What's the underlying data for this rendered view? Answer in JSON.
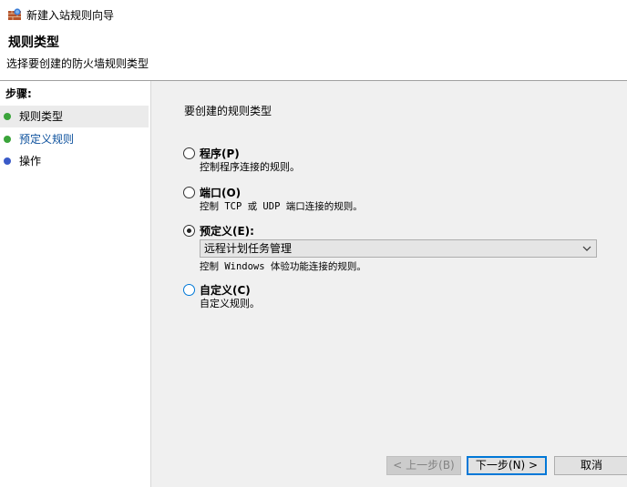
{
  "window": {
    "title": "新建入站规则向导",
    "icon": "firewall-shield-icon"
  },
  "header": {
    "title": "规则类型",
    "subtitle": "选择要创建的防火墙规则类型"
  },
  "steps": {
    "title": "步骤:",
    "items": [
      {
        "label": "规则类型",
        "color": "#3aa43a",
        "selected": true
      },
      {
        "label": "预定义规则",
        "color": "#3aa43a",
        "selected": false
      },
      {
        "label": "操作",
        "color": "#3a5ac8",
        "selected": false
      }
    ]
  },
  "content": {
    "title": "要创建的规则类型",
    "options": [
      {
        "label": "程序(P)",
        "desc": "控制程序连接的规则。",
        "checked": false
      },
      {
        "label": "端口(O)",
        "desc": "控制 TCP 或 UDP 端口连接的规则。",
        "checked": false
      },
      {
        "label": "预定义(E):",
        "desc": "控制 Windows 体验功能连接的规则。",
        "checked": true
      },
      {
        "label": "自定义(C)",
        "desc": "自定义规则。",
        "checked": false
      }
    ],
    "predefined_select": {
      "value": "远程计划任务管理"
    }
  },
  "buttons": {
    "back": "< 上一步(B)",
    "next": "下一步(N) >",
    "cancel": "取消"
  },
  "colors": {
    "accent": "#0078d7",
    "panel": "#f0f0f0"
  }
}
